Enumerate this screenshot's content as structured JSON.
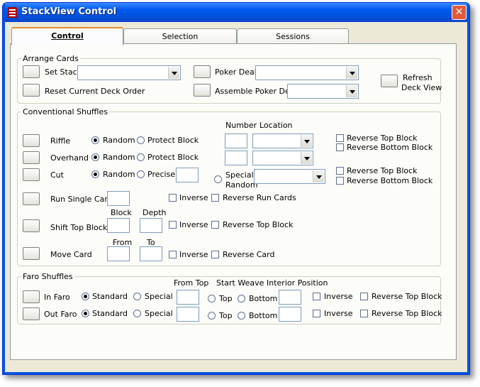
{
  "window": {
    "title": "StackView Control",
    "close_label": "✕"
  },
  "tabs": [
    {
      "label": "Control",
      "active": true
    },
    {
      "label": "Selection",
      "active": false
    },
    {
      "label": "Sessions",
      "active": false
    }
  ],
  "arrange": {
    "group_label": "Arrange Cards",
    "set_stack": "Set Stack",
    "reset": "Reset Current Deck Order",
    "poker_deal": "Poker Deal",
    "assemble": "Assemble Poker Deal",
    "refresh": "Refresh",
    "refresh2": "Deck View"
  },
  "conv": {
    "group_label": "Conventional Shuffles",
    "number": "Number",
    "location": "Location",
    "riffle": "Riffle",
    "overhand": "Overhand",
    "cut": "Cut",
    "random": "Random",
    "protect_block": "Protect Block",
    "precise": "Precise",
    "special": "Special",
    "special_random": "Random",
    "reverse_top_block": "Reverse Top Block",
    "reverse_bottom_block": "Reverse Bottom Block",
    "run_single": "Run Single Cards",
    "inverse": "Inverse",
    "reverse_run": "Reverse Run Cards",
    "block": "Block",
    "depth": "Depth",
    "shift_top": "Shift Top Block",
    "from": "From",
    "to": "To",
    "move_card": "Move Card",
    "reverse_card": "Reverse Card"
  },
  "faro": {
    "group_label": "Faro Shuffles",
    "in_faro": "In Faro",
    "out_faro": "Out Faro",
    "standard": "Standard",
    "special": "Special",
    "from_top": "From Top",
    "start_weave": "Start Weave",
    "interior": "Interior Position",
    "top": "Top",
    "bottom": "Bottom",
    "inverse": "Inverse",
    "reverse_top_block": "Reverse Top Block"
  }
}
